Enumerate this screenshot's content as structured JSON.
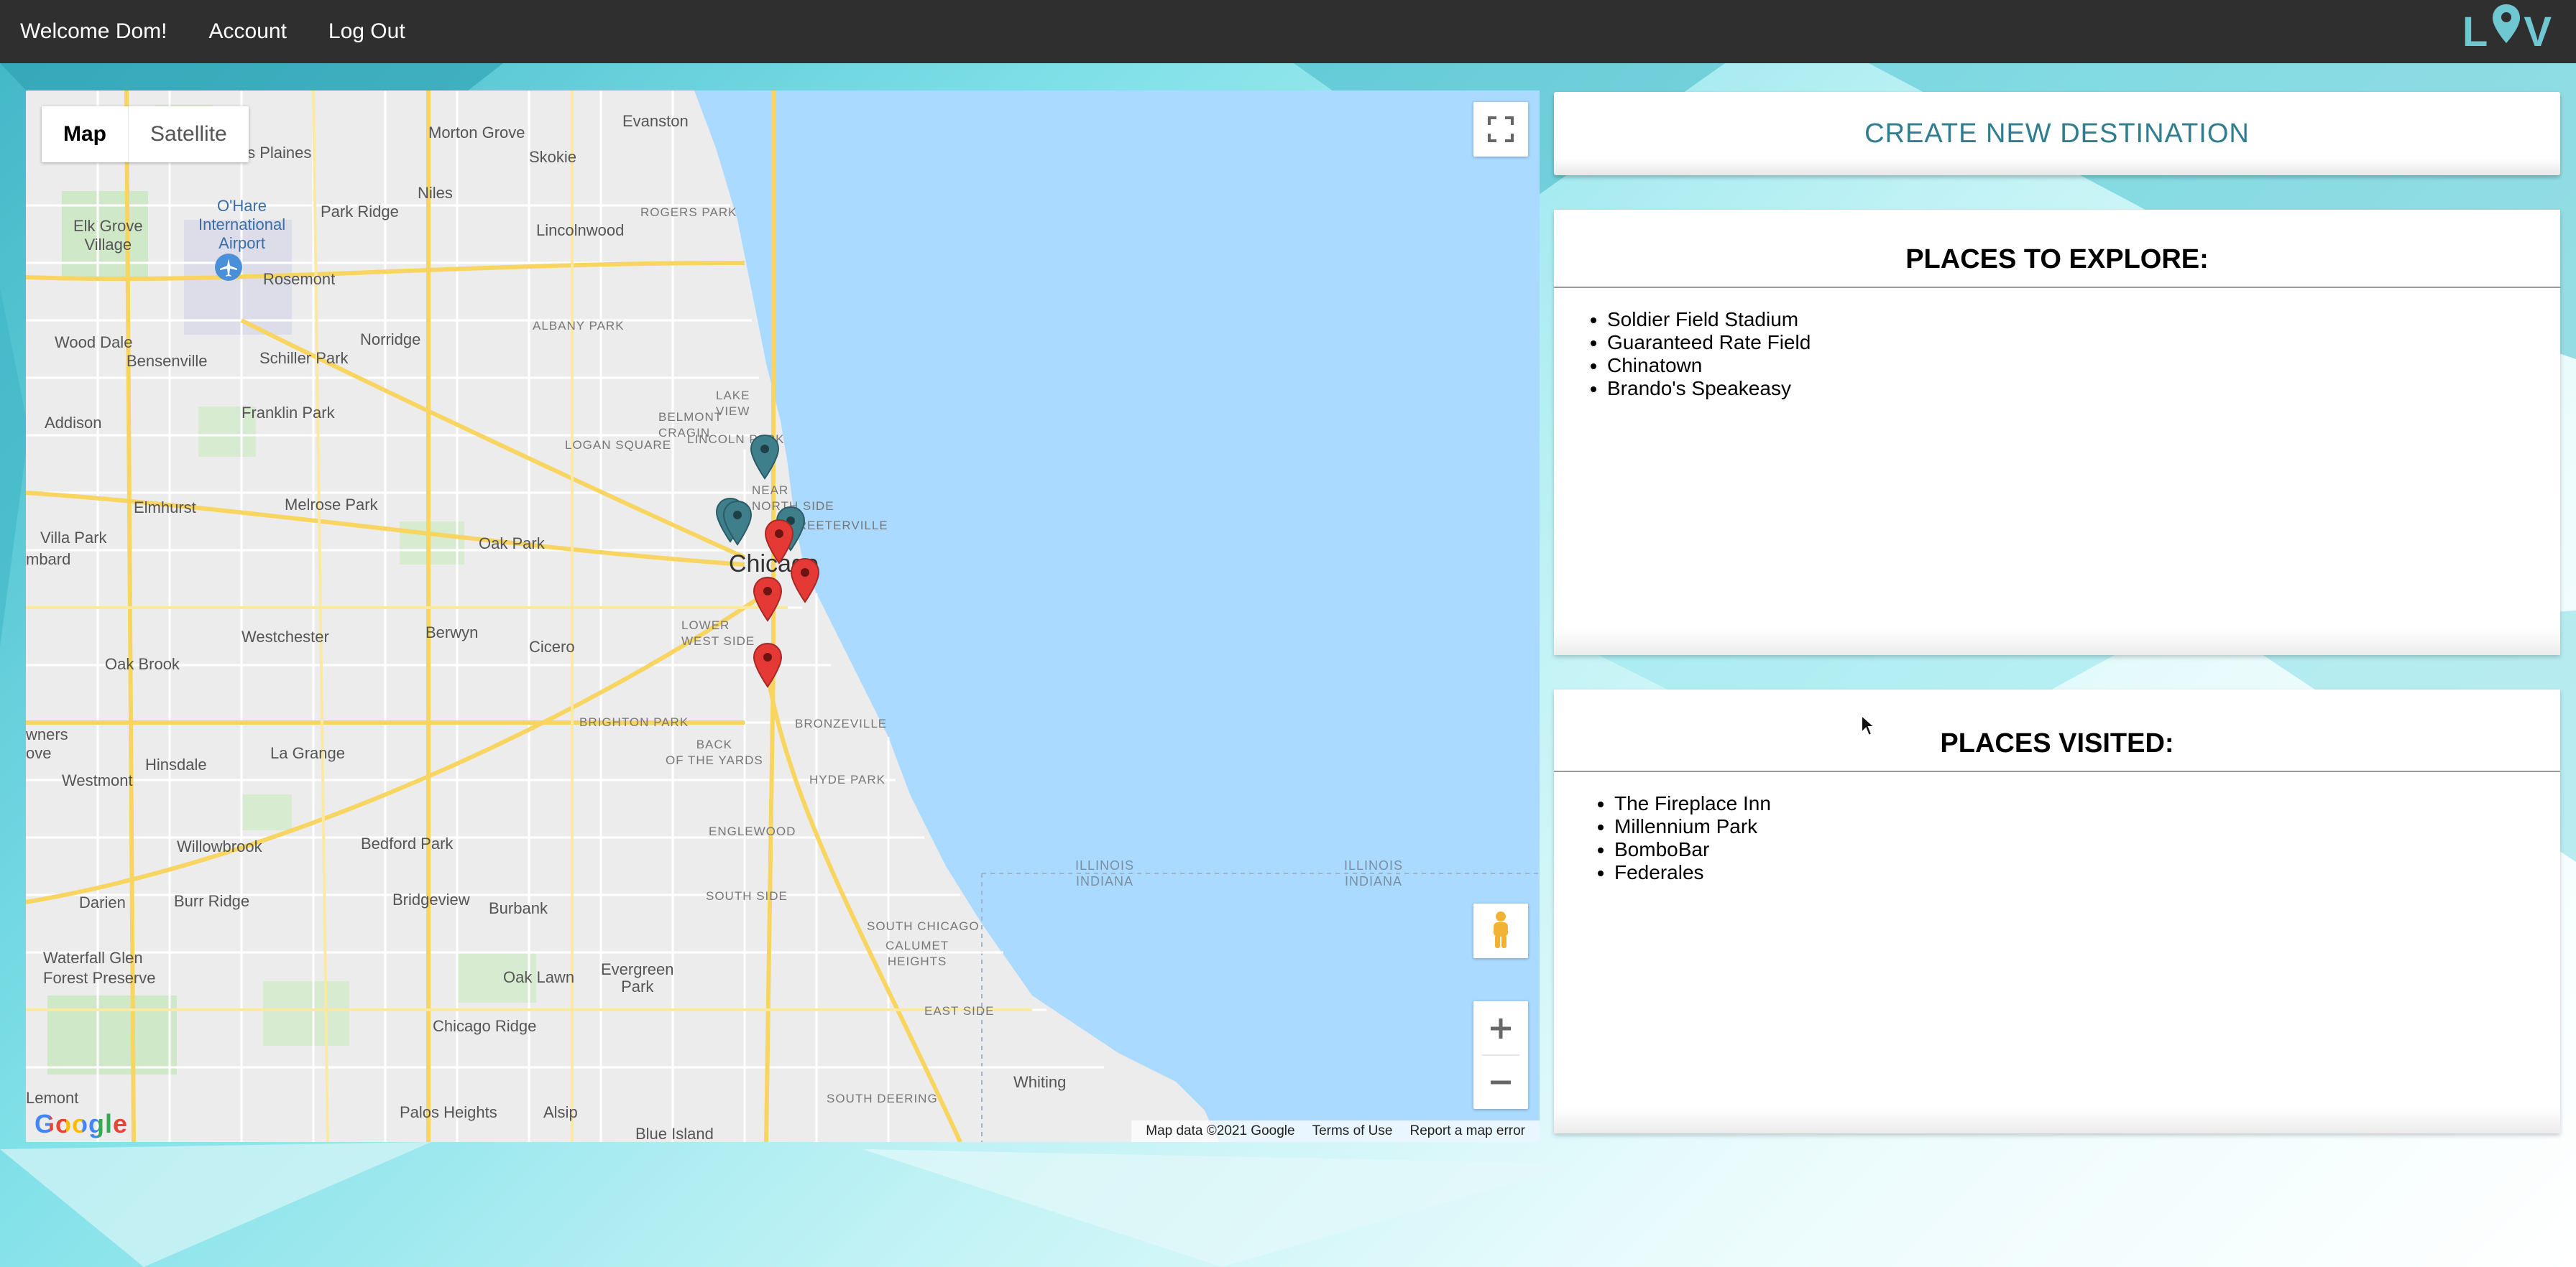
{
  "nav": {
    "welcome": "Welcome Dom!",
    "account": "Account",
    "logout": "Log Out",
    "logo_left": "L",
    "logo_right": "V"
  },
  "map": {
    "type_map": "Map",
    "type_satellite": "Satellite",
    "google_logo": "Google",
    "footer_data": "Map data ©2021 Google",
    "footer_terms": "Terms of Use",
    "footer_report": "Report a map error",
    "labels": {
      "evanston": "Evanston",
      "des_plaines": "Des Plaines",
      "morton_grove": "Morton Grove",
      "skokie": "Skokie",
      "ohare": "O'Hare\nInternational\nAirport",
      "park_ridge": "Park Ridge",
      "niles": "Niles",
      "lincolnwood": "Lincolnwood",
      "rogers_park": "ROGERS PARK",
      "elk_grove": "Elk Grove\nVillage",
      "rosemont": "Rosemont",
      "wood_dale": "Wood Dale",
      "bensenville": "Bensenville",
      "schiller_park": "Schiller Park",
      "norridge": "Norridge",
      "albany_park": "ALBANY PARK",
      "franklin_park": "Franklin Park",
      "addison": "Addison",
      "lake_view": "LAKE\nVIEW",
      "belmont_cragin": "BELMONT\nCRAGIN",
      "logan_square": "LOGAN SQUARE",
      "lincoln_park": "LINCOLN PARK",
      "elmhurst": "Elmhurst",
      "melrose_park": "Melrose Park",
      "near_north_side": "NEAR\nNORTH SIDE",
      "streeterville": "STREETERVILLE",
      "villa_park": "Villa Park",
      "oak_park": "Oak Park",
      "mbard": "mbard",
      "chicago": "Chicago",
      "westchester": "Westchester",
      "berwyn": "Berwyn",
      "cicero": "Cicero",
      "lower_west_side": "LOWER\nWEST SIDE",
      "oak_brook": "Oak Brook",
      "brighton_park": "BRIGHTON PARK",
      "bronzeville": "BRONZEVILLE",
      "owners_grove": "wners\nove",
      "la_grange": "La Grange",
      "back_of_the_yards": "BACK\nOF THE YARDS",
      "westmont": "Westmont",
      "hinsdale": "Hinsdale",
      "hyde_park": "HYDE PARK",
      "englewood": "ENGLEWOOD",
      "willowbrook": "Willowbrook",
      "bedford_park": "Bedford Park",
      "darien": "Darien",
      "burr_ridge": "Burr Ridge",
      "bridgeview": "Bridgeview",
      "burbank": "Burbank",
      "south_side": "SOUTH SIDE",
      "illinois_indiana_1": "ILLINOIS\nINDIANA",
      "illinois_indiana_2": "ILLINOIS\nINDIANA",
      "waterfall_glen": "Waterfall Glen\nForest Preserve",
      "south_chicago": "SOUTH CHICAGO",
      "calumet_heights": "CALUMET\nHEIGHTS",
      "oak_lawn": "Oak Lawn",
      "evergreen_park": "Evergreen\nPark",
      "chicago_ridge": "Chicago Ridge",
      "east_side": "EAST SIDE",
      "south_deering": "SOUTH DEERING",
      "whiting": "Whiting",
      "lemont": "Lemont",
      "palos_heights": "Palos Heights",
      "alsip": "Alsip",
      "blue_island": "Blue Island"
    }
  },
  "create_button": "CREATE NEW DESTINATION",
  "explore": {
    "title": "PLACES TO EXPLORE:",
    "items": [
      "Soldier Field Stadium",
      "Guaranteed Rate Field",
      "Chinatown",
      "Brando's Speakeasy"
    ]
  },
  "visited": {
    "title": "PLACES VISITED:",
    "items": [
      "The Fireplace Inn",
      "Millennium Park",
      "BomboBar",
      "Federales"
    ]
  },
  "colors": {
    "nav_bg": "#2f2f2f",
    "accent": "#2f7d8e",
    "logo": "#6fc7d2",
    "marker_red": "#e53935",
    "marker_teal": "#3f7f8c",
    "water": "#aadaff"
  }
}
